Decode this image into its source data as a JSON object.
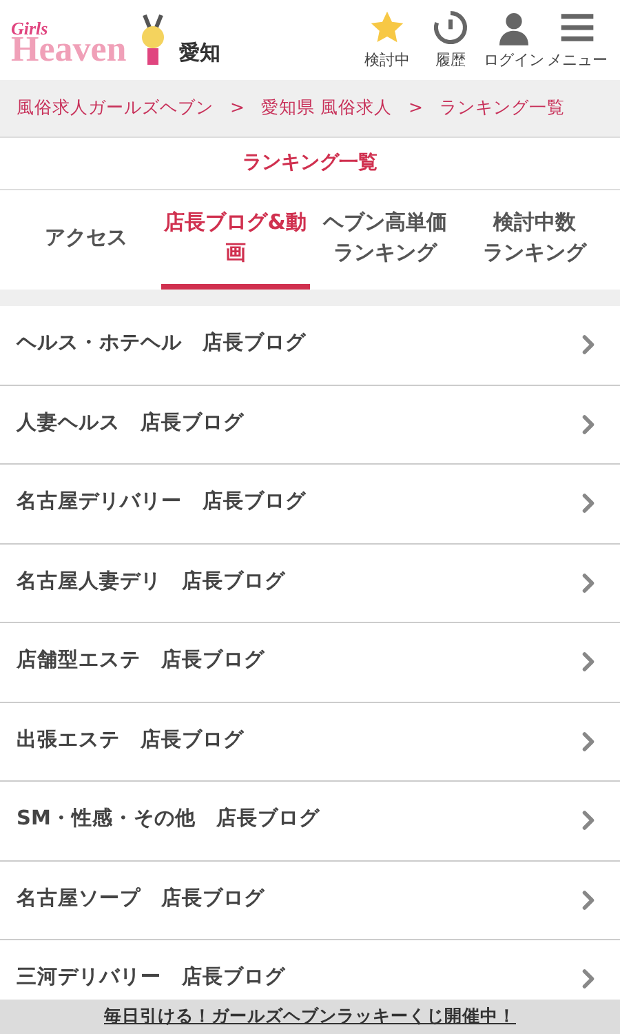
{
  "header": {
    "logo_words": [
      "Girls",
      "Heaven"
    ],
    "region": "愛知",
    "actions": [
      {
        "kind": "star",
        "label": "検討中"
      },
      {
        "kind": "history",
        "label": "履歴"
      },
      {
        "kind": "user",
        "label": "ログイン"
      },
      {
        "kind": "menu",
        "label": "メニュー"
      }
    ]
  },
  "breadcrumb": [
    "風俗求人ガールズヘブン",
    "愛知県 風俗求人",
    "ランキング一覧"
  ],
  "breadcrumb_separator": ">",
  "page_title": "ランキング一覧",
  "tabs": [
    {
      "lines": [
        "アクセス"
      ],
      "selected": false
    },
    {
      "lines": [
        "店長ブログ&動",
        "画"
      ],
      "selected": true
    },
    {
      "lines": [
        "ヘブン高単価",
        "ランキング"
      ],
      "selected": false
    },
    {
      "lines": [
        "検討中数",
        "ランキング"
      ],
      "selected": false
    }
  ],
  "rows": [
    {
      "label": "ヘルス・ホテヘル　店長ブログ"
    },
    {
      "label": "人妻ヘルス　店長ブログ"
    },
    {
      "label": "名古屋デリバリー　店長ブログ"
    },
    {
      "label": "名古屋人妻デリ　店長ブログ"
    },
    {
      "label": "店舗型エステ　店長ブログ"
    },
    {
      "label": "出張エステ　店長ブログ"
    },
    {
      "label": "SM・性感・その他　店長ブログ"
    },
    {
      "label": "名古屋ソープ　店長ブログ"
    },
    {
      "label": "三河デリバリー　店長ブログ"
    }
  ],
  "banner": "毎日引ける！ガールズヘブンラッキーくじ開催中！"
}
